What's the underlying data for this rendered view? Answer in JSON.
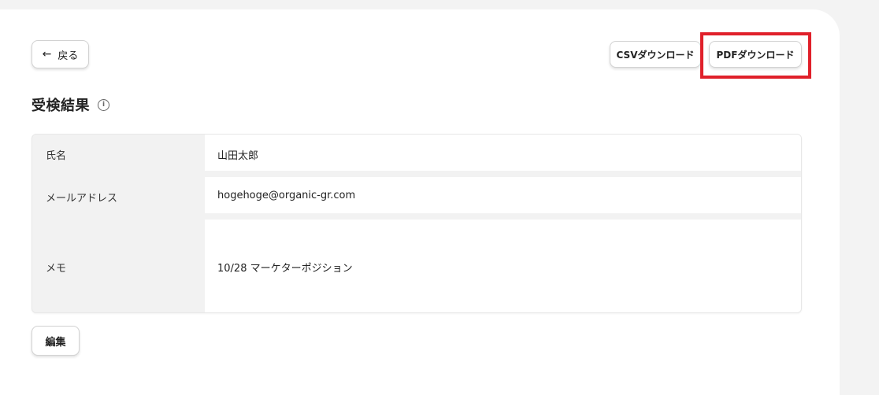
{
  "header": {
    "back_arrow": "←",
    "back_label": "戻る",
    "csv_download_label": "CSVダウンロード",
    "pdf_download_label": "PDFダウンロード"
  },
  "title": {
    "text": "受検結果",
    "info_icon": "i"
  },
  "details": {
    "rows": [
      {
        "label": "氏名",
        "value": "山田太郎"
      },
      {
        "label": "メールアドレス",
        "value": "hogehoge@organic-gr.com"
      },
      {
        "label": "メモ",
        "value": "10/28 マーケターポジション"
      }
    ]
  },
  "actions": {
    "edit_label": "編集"
  },
  "colors": {
    "highlight": "#e0202a",
    "page_background": "#f3f3f3",
    "label_cell_background": "#f2f2f2"
  }
}
